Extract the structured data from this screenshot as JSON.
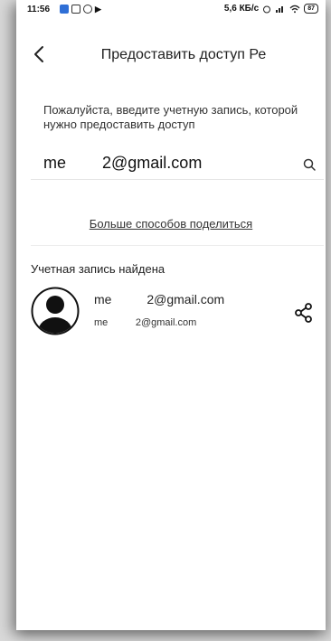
{
  "status_bar": {
    "time": "11:56",
    "speed": "5,6 КБ/с",
    "battery": "87"
  },
  "header": {
    "title": "Предоставить доступ Ре"
  },
  "form": {
    "prompt": "Пожалуйста, введите учетную запись, которой нужно предоставить доступ",
    "email_value": "me        2@gmail.com"
  },
  "links": {
    "more_share": "Больше способов поделиться"
  },
  "result": {
    "found_label": "Учетная запись найдена",
    "account_name": "me          2@gmail.com",
    "account_sub": "me          2@gmail.com"
  }
}
